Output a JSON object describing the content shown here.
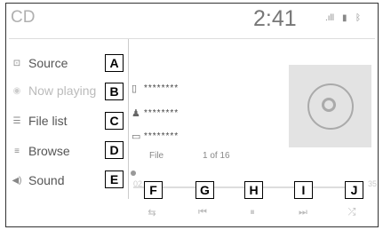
{
  "header": {
    "title": "CD",
    "clock": "2:41"
  },
  "menu": [
    {
      "label": "Source",
      "icon": "source-icon",
      "glyph": "⊡",
      "callout": "A",
      "enabled": true
    },
    {
      "label": "Now playing",
      "icon": "now-playing-icon",
      "glyph": "◉",
      "callout": "B",
      "enabled": false
    },
    {
      "label": "File list",
      "icon": "file-list-icon",
      "glyph": "☰",
      "callout": "C",
      "enabled": true
    },
    {
      "label": "Browse",
      "icon": "browse-icon",
      "glyph": "≡",
      "callout": "D",
      "enabled": true
    },
    {
      "label": "Sound",
      "icon": "sound-icon",
      "glyph": "◀)",
      "callout": "E",
      "enabled": true
    }
  ],
  "track": {
    "file_name": "********",
    "artist": "********",
    "folder": "********",
    "file_label": "File",
    "position": "1 of 16"
  },
  "playback": {
    "elapsed": "02",
    "remaining": "35",
    "progress_fraction": 0.0
  },
  "controls": [
    {
      "name": "repeat",
      "glyph": "⇆",
      "callout": "F"
    },
    {
      "name": "previous",
      "glyph": "⏮",
      "callout": "G"
    },
    {
      "name": "pause",
      "glyph": "⏸",
      "callout": "H"
    },
    {
      "name": "next",
      "glyph": "⏭",
      "callout": "I"
    },
    {
      "name": "shuffle",
      "glyph": "⤮",
      "callout": "J"
    }
  ],
  "colors": {
    "text": "#555555",
    "disabled": "#bbbbbb",
    "callout_border": "#000000"
  }
}
